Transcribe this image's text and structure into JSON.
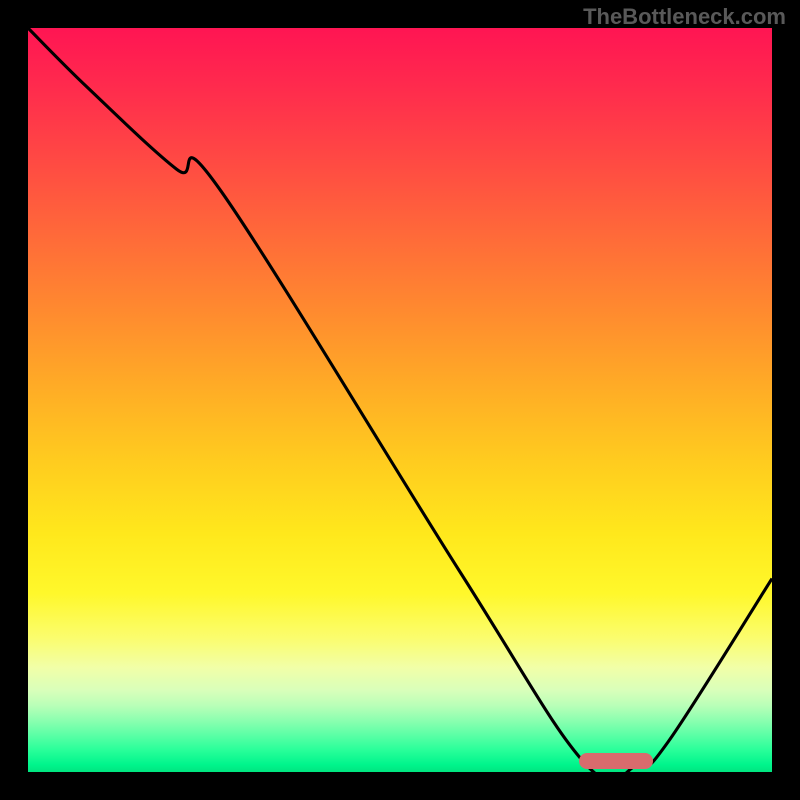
{
  "watermark": "TheBottleneck.com",
  "chart_data": {
    "type": "line",
    "x": [
      0,
      8,
      20,
      26,
      58,
      75,
      82,
      86,
      100
    ],
    "values": [
      100,
      92,
      81,
      78,
      27,
      1,
      1,
      4,
      26
    ],
    "title": "",
    "xlabel": "",
    "ylabel": "",
    "xlim": [
      0,
      100
    ],
    "ylim": [
      0,
      100
    ],
    "marker": {
      "x_start": 74,
      "x_end": 84,
      "y": 1.5,
      "color": "#d86b6d"
    },
    "background": "red-yellow-green-vertical-gradient"
  }
}
